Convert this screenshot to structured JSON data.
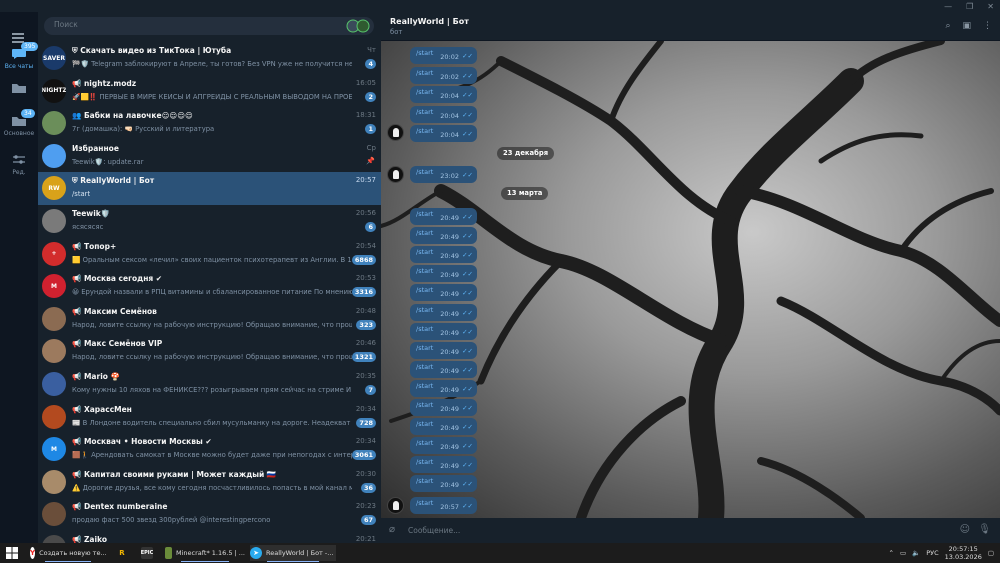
{
  "sidebar_rail": {
    "all_chats_label": "Все чаты",
    "all_chats_badge": "395",
    "main_label": "Основное",
    "main_badge": "34",
    "edit_label": "Ред."
  },
  "search": {
    "placeholder": "Поиск"
  },
  "chats": [
    {
      "title": "Скачать видео из ТикТока | Ютуба",
      "prefix": "⛨",
      "time": "Чт",
      "preview": "🏁🛡️ Telegram заблокируют в Апреле, ты готов?  Без VPN уже не получится не то, что...",
      "badge": "4",
      "avatar_text": "SAVER",
      "avatar_color": "#1a3a6a"
    },
    {
      "title": "nightz.modz",
      "prefix": "📢",
      "time": "16:05",
      "preview": "🚀🟨‼️ ПЕРВЫЕ В МИРЕ КЕЙСЫ И АПГРЕЙДЫ С РЕАЛЬНЫМ ВЫВОДОМ НА ПРОЕ...",
      "badge": "2",
      "avatar_text": "NIGHTZ",
      "avatar_color": "#111111"
    },
    {
      "title": "Бабки на лавочке😌😌😌😌",
      "prefix": "👥",
      "time": "18:31",
      "preview": "7г (домашка): 🤜🏻 Русский и литература",
      "badge": "1",
      "avatar_text": "",
      "avatar_color": "#6b8e5a"
    },
    {
      "title": "Избранное",
      "prefix": "",
      "time": "Ср",
      "preview": "Teewik🛡️: update.rar",
      "badge": "",
      "pinned": "true",
      "avatar_text": "",
      "avatar_color": "#4f9ef0"
    },
    {
      "title": "ReallyWorld | Бот",
      "prefix": "⛨",
      "time": "20:57",
      "preview": "/start",
      "badge": "",
      "active": "true",
      "avatar_text": "RW",
      "avatar_color": "#d9a21a"
    },
    {
      "title": "Teewik🛡️",
      "prefix": "",
      "time": "20:56",
      "preview": "ясясясяс",
      "badge": "6",
      "avatar_text": "",
      "avatar_color": "#7a7a7a"
    },
    {
      "title": "Топор+",
      "prefix": "📢",
      "time": "20:54",
      "preview": "🟨 Оральным сексом «лечил» своих пациенток психотерапевт из Англии. В 1980...",
      "badge": "6868",
      "avatar_text": "+",
      "avatar_color": "#d22c2c"
    },
    {
      "title": "Москва сегодня ✔",
      "prefix": "📢",
      "time": "20:53",
      "preview": "😀 Ерундой назвали в РПЦ витамины и сбалансированное питание   По мнению п...",
      "badge": "3316",
      "avatar_text": "M",
      "avatar_color": "#d0212f"
    },
    {
      "title": "Максим Семёнов",
      "prefix": "📢",
      "time": "20:48",
      "preview": "Народ, ловите ссылку на рабочую инструкцию!  Обращаю внимание, что прошлые ...",
      "badge": "323",
      "avatar_text": "",
      "avatar_color": "#8b6b52"
    },
    {
      "title": "Макс Семёнов VIP",
      "prefix": "📢",
      "time": "20:46",
      "preview": "Народ, ловите ссылку на рабочую инструкцию!  Обращаю внимание, что прошлые ...",
      "badge": "1321",
      "avatar_text": "",
      "avatar_color": "#9c7a5e"
    },
    {
      "title": "Mario 🍄",
      "prefix": "📢",
      "time": "20:35",
      "preview": "Кому нужны 10 ляхов на ФЕНИКСЕ???  розыгрываем прям сейчас на стриме  И трасск...",
      "badge": "7",
      "avatar_text": "",
      "avatar_color": "#3a5fa0"
    },
    {
      "title": "ХарассМен",
      "prefix": "📢",
      "time": "20:34",
      "preview": "📰 В Лондоне водитель специально сбил мусульманку на дороге.  Неадекват увидк...",
      "badge": "728",
      "avatar_text": "",
      "avatar_color": "#b34a1f"
    },
    {
      "title": "Москвач • Новости Москвы ✔",
      "prefix": "📢",
      "time": "20:34",
      "preview": "🟫🚶 Арендовать самокат в Москве можно будет даже при непогодах с интернет...",
      "badge": "3061",
      "avatar_text": "M",
      "avatar_color": "#1e88e5"
    },
    {
      "title": "Капитал своими руками | Может каждый 🇷🇺",
      "prefix": "📢",
      "time": "20:30",
      "preview": "⚠️ Дорогие друзья, все кому сегодня посчастливилось попасть в мой канал може...",
      "badge": "36",
      "avatar_text": "",
      "avatar_color": "#a88b6a"
    },
    {
      "title": "Dentex numberaine",
      "prefix": "📢",
      "time": "20:23",
      "preview": "продаю фаст 500 звезд 300рублей @interestingpercono",
      "badge": "67",
      "avatar_text": "",
      "avatar_color": "#6a4e3a"
    },
    {
      "title": "Zaiko",
      "prefix": "📢",
      "time": "20:21",
      "preview": "",
      "badge": "",
      "avatar_text": "",
      "avatar_color": "#4a4a4a"
    }
  ],
  "chat": {
    "title": "ReallyWorld | Бот",
    "subtitle": "бот",
    "composer_placeholder": "Сообщение...",
    "date_dec": "23 декабря",
    "date_mar": "13 марта",
    "messages_top": [
      {
        "text": "/start",
        "time": "20:02"
      },
      {
        "text": "/start",
        "time": "20:02"
      },
      {
        "text": "/start",
        "time": "20:04"
      },
      {
        "text": "/start",
        "time": "20:04"
      },
      {
        "text": "/start",
        "time": "20:04"
      }
    ],
    "message_dec": {
      "text": "/start",
      "time": "23:02"
    },
    "messages_mar": [
      {
        "text": "/start",
        "time": "20:49"
      },
      {
        "text": "/start",
        "time": "20:49"
      },
      {
        "text": "/start",
        "time": "20:49"
      },
      {
        "text": "/start",
        "time": "20:49"
      },
      {
        "text": "/start",
        "time": "20:49"
      },
      {
        "text": "/start",
        "time": "20:49"
      },
      {
        "text": "/start",
        "time": "20:49"
      },
      {
        "text": "/start",
        "time": "20:49"
      },
      {
        "text": "/start",
        "time": "20:49"
      },
      {
        "text": "/start",
        "time": "20:49"
      },
      {
        "text": "/start",
        "time": "20:49"
      },
      {
        "text": "/start",
        "time": "20:49"
      },
      {
        "text": "/start",
        "time": "20:49"
      },
      {
        "text": "/start",
        "time": "20:49"
      },
      {
        "text": "/start",
        "time": "20:49"
      }
    ],
    "message_last": {
      "text": "/start",
      "time": "20:57"
    }
  },
  "taskbar": {
    "browser_label": "Создать новую те...",
    "minecraft_label": "Minecraft* 1.16.5 | ...",
    "telegram_label": "ReallyWorld | Бот -...",
    "lang": "РУС",
    "time": "20:57:15",
    "date": "13.03.2026"
  },
  "colors": {
    "accent": "#5eb5f7",
    "bubble": "#2b5278",
    "panel": "#17212b",
    "rail": "#0e1621",
    "badge": "#4082bc"
  }
}
